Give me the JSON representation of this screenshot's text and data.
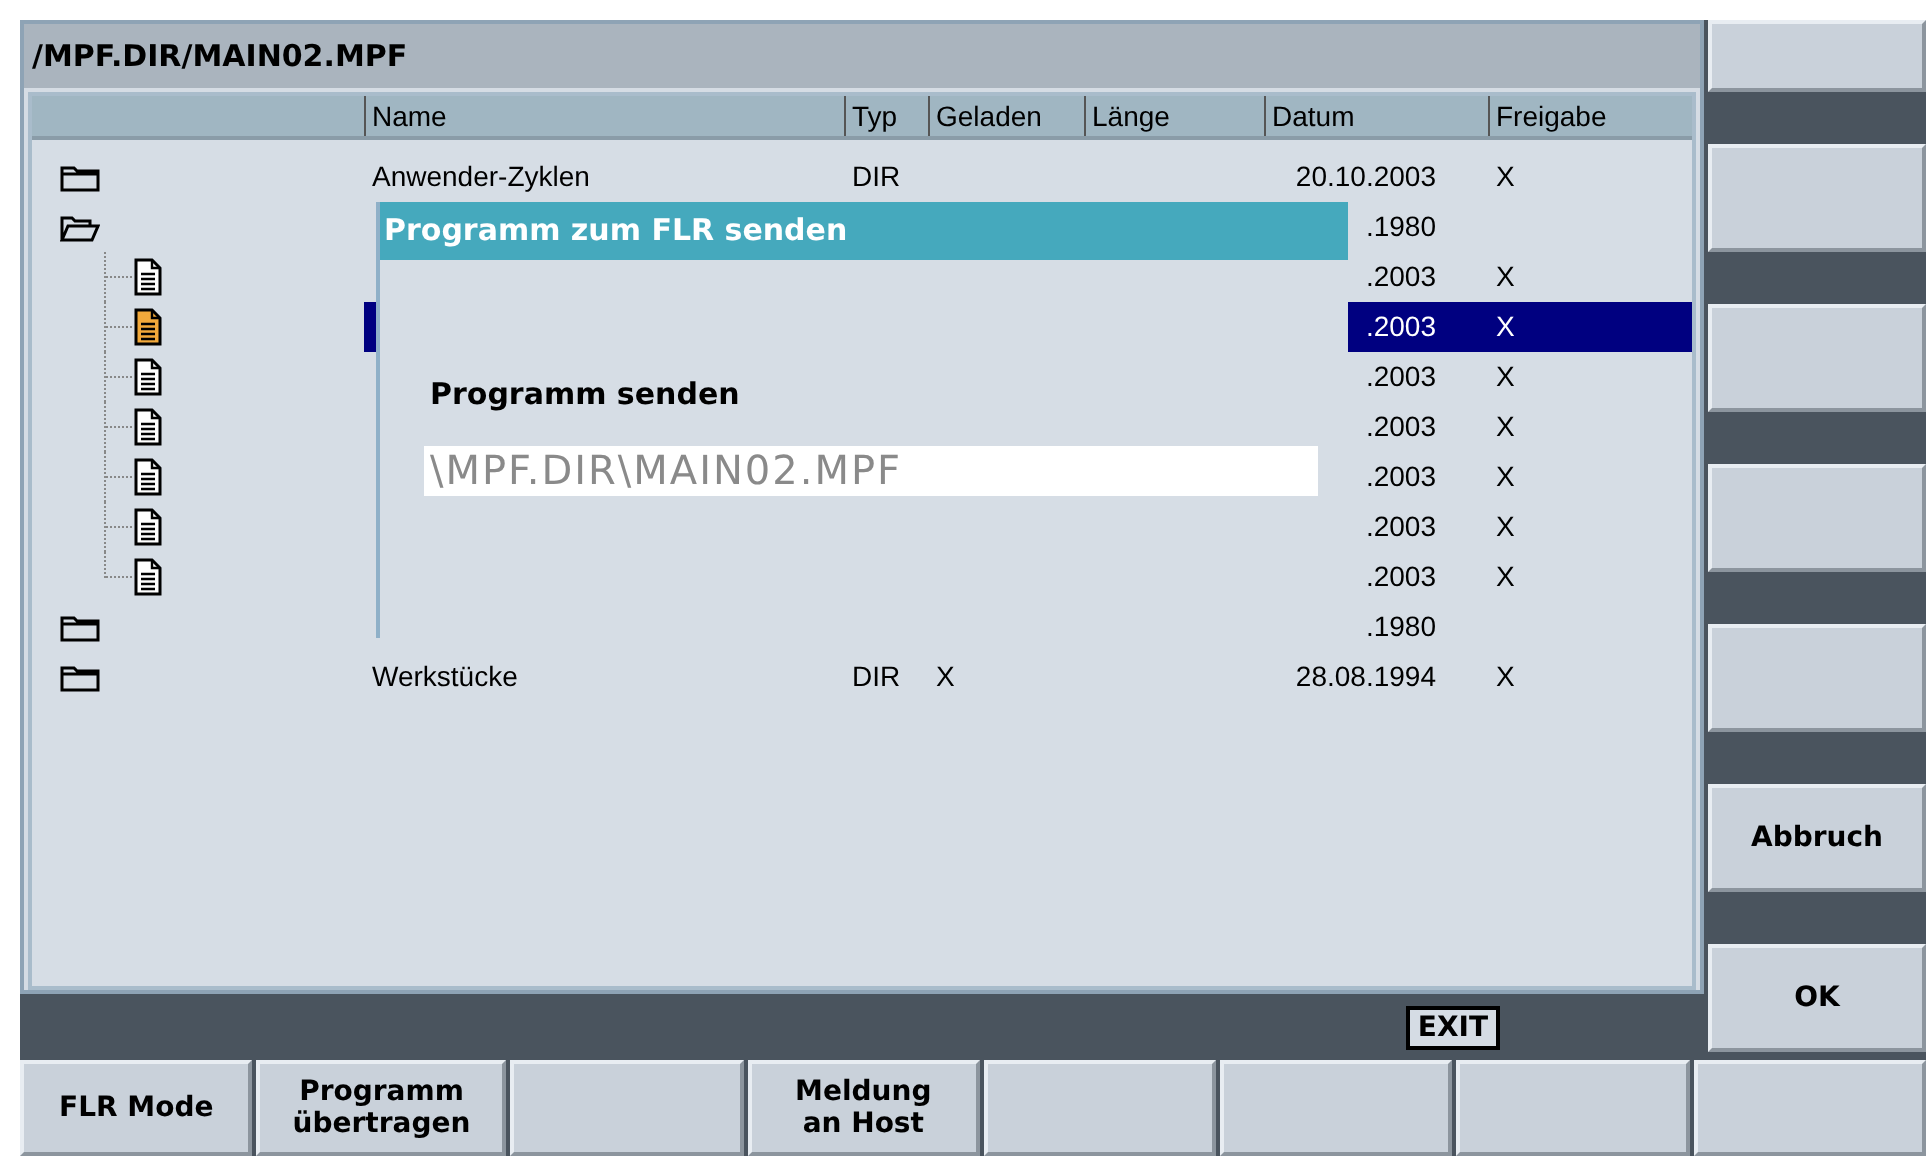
{
  "path_bar": {
    "title": "/MPF.DIR/MAIN02.MPF"
  },
  "table": {
    "columns": [
      "Name",
      "Typ",
      "Geladen",
      "Länge",
      "Datum",
      "Freigabe"
    ],
    "rows": [
      {
        "kind": "folder",
        "expanded": false,
        "selected": false,
        "name": "Anwender-Zyklen",
        "typ": "DIR",
        "datum": "20.10.2003",
        "freigabe": "X"
      },
      {
        "kind": "folder",
        "expanded": true,
        "selected": false,
        "datum": ".1980",
        "children": [
          {
            "kind": "file",
            "selected": false,
            "datum": ".2003",
            "freigabe": "X"
          },
          {
            "kind": "file",
            "selected": true,
            "datum": ".2003",
            "freigabe": "X"
          },
          {
            "kind": "file",
            "selected": false,
            "datum": ".2003",
            "freigabe": "X"
          },
          {
            "kind": "file",
            "selected": false,
            "datum": ".2003",
            "freigabe": "X"
          },
          {
            "kind": "file",
            "selected": false,
            "datum": ".2003",
            "freigabe": "X"
          },
          {
            "kind": "file",
            "selected": false,
            "datum": ".2003",
            "freigabe": "X"
          },
          {
            "kind": "file",
            "selected": false,
            "datum": ".2003",
            "freigabe": "X"
          }
        ]
      },
      {
        "kind": "folder",
        "expanded": false,
        "selected": false,
        "datum": ".1980"
      },
      {
        "kind": "folder",
        "expanded": false,
        "selected": false,
        "name": "Werkstücke",
        "typ": "DIR",
        "geladen": "X",
        "datum": "28.08.1994",
        "freigabe": "X"
      }
    ]
  },
  "dialog": {
    "title": "Programm zum FLR senden",
    "label": "Programm senden",
    "value": "\\MPF.DIR\\MAIN02.MPF"
  },
  "exit_label": "EXIT",
  "right_softkeys": [
    {
      "kind": "blank"
    },
    {
      "kind": "blank"
    },
    {
      "kind": "blank"
    },
    {
      "kind": "blank"
    },
    {
      "kind": "blank"
    },
    {
      "kind": "labeled",
      "label": "Abbruch"
    },
    {
      "kind": "labeled",
      "label": "OK"
    }
  ],
  "bottom_softkeys": [
    {
      "kind": "labeled",
      "label": "FLR Mode"
    },
    {
      "kind": "labeled",
      "label": "Programm übertragen"
    },
    {
      "kind": "blank"
    },
    {
      "kind": "labeled",
      "label": "Meldung an Host"
    },
    {
      "kind": "blank"
    },
    {
      "kind": "blank"
    },
    {
      "kind": "blank"
    },
    {
      "kind": "blank"
    }
  ]
}
